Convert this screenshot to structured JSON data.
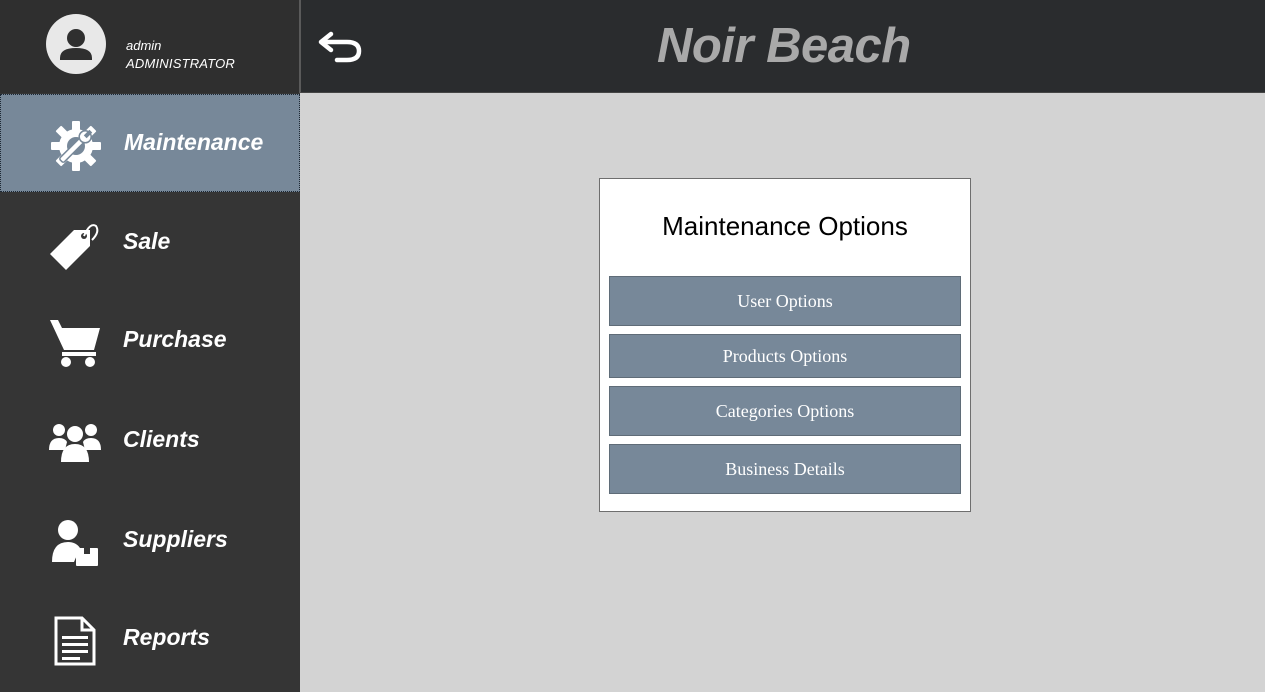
{
  "user": {
    "name": "admin",
    "role": "ADMINISTRATOR",
    "avatar_icon": "user-avatar-icon"
  },
  "header": {
    "title": "Noir Beach",
    "back_icon": "back-arrow-icon"
  },
  "sidebar": {
    "items": [
      {
        "label": "Maintenance",
        "icon": "gear-wrench-icon",
        "active": true
      },
      {
        "label": "Sale",
        "icon": "price-tag-icon",
        "active": false
      },
      {
        "label": "Purchase",
        "icon": "shopping-cart-icon",
        "active": false
      },
      {
        "label": "Clients",
        "icon": "users-group-icon",
        "active": false
      },
      {
        "label": "Suppliers",
        "icon": "supplier-icon",
        "active": false
      },
      {
        "label": "Reports",
        "icon": "document-icon",
        "active": false
      }
    ]
  },
  "main": {
    "panel_title": "Maintenance Options",
    "buttons": [
      {
        "label": "User Options"
      },
      {
        "label": "Products Options"
      },
      {
        "label": "Categories Options"
      },
      {
        "label": "Business Details"
      }
    ]
  },
  "colors": {
    "sidebar_bg": "#353535",
    "header_bg": "#2a2c2e",
    "accent": "#778899",
    "content_bg": "#d3d3d3",
    "title_text": "#a9a9a9"
  }
}
